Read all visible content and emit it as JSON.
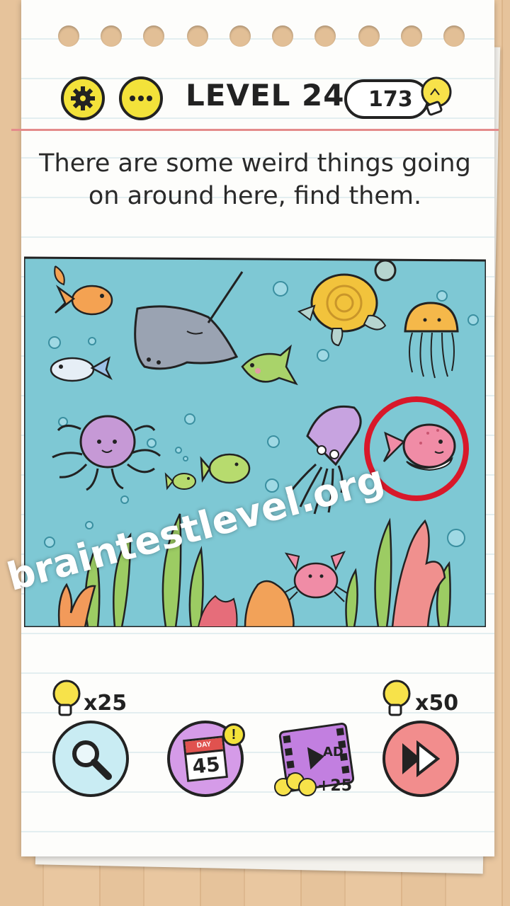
{
  "header": {
    "level_label": "LEVEL 244",
    "hint_count": "173",
    "settings_icon": "gear-icon",
    "menu_icon": "more-dots-icon"
  },
  "instruction": {
    "line1": "There are some weird things going",
    "line2": "on around here, find them."
  },
  "scene": {
    "background_color": "#7ec8d4",
    "items": [
      "goldfish",
      "stingray",
      "sea-turtle",
      "jellyfish",
      "small-blue-fish",
      "angelfish",
      "octopus",
      "tiny-fish",
      "green-fish",
      "squid",
      "pufferfish",
      "crab",
      "coral",
      "seaweed",
      "bubbles"
    ],
    "found_marker_color": "#d8182a"
  },
  "watermark": "braintestlevel.org",
  "tools": {
    "magnifier": {
      "cost": "x25",
      "icon": "magnifier-icon"
    },
    "daily": {
      "day_label": "DAY",
      "day_number": "45",
      "badge": "!",
      "icon": "calendar-icon"
    },
    "ad": {
      "label": "AD",
      "reward": "+25",
      "icon": "video-film-icon"
    },
    "skip": {
      "cost": "x50",
      "icon": "skip-forward-icon"
    }
  },
  "colors": {
    "yellow": "#f3e23a",
    "purple": "#d59be8",
    "pink": "#f28d8d",
    "light_blue": "#c9ecf3"
  }
}
